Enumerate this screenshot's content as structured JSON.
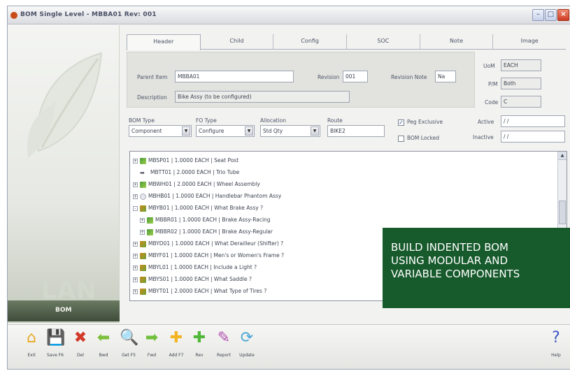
{
  "window": {
    "title": "BOM Single Level - MBBA01  Rev: 001"
  },
  "tabs": [
    "Header",
    "Child",
    "Config",
    "SOC",
    "Note",
    "Image"
  ],
  "header": {
    "parent_item_label": "Parent Item",
    "parent_item_value": "MBBA01",
    "revision_label": "Revision",
    "revision_value": "001",
    "revision_note_label": "Revision Note",
    "revision_note_value": "Na",
    "description_label": "Description",
    "description_value": "Bike Assy (to be configured)",
    "uom_label": "UoM",
    "uom_value": "EACH",
    "pm_label": "P/M",
    "pm_value": "Both",
    "code_label": "Code",
    "code_value": "C"
  },
  "selects": {
    "bom_type_label": "BOM Type",
    "bom_type_value": "Component",
    "fo_type_label": "FO Type",
    "fo_type_value": "Configure",
    "allocation_label": "Allocation",
    "allocation_value": "Std Qty",
    "route_label": "Route",
    "route_value": "BIKE2",
    "peg_exclusive_label": "Peg Exclusive",
    "peg_exclusive_checked": true,
    "bom_locked_label": "BOM Locked",
    "bom_locked_checked": false,
    "active_label": "Active",
    "active_value": "/ /",
    "inactive_label": "Inactive",
    "inactive_value": "/ /"
  },
  "tree": [
    {
      "expander": "+",
      "icon": "mod",
      "text": "MBSP01 | 1.0000 EACH | Seat Post"
    },
    {
      "expander": "",
      "icon": "arrow",
      "text": "MBTT01 | 2.0000 EACH | Trio Tube"
    },
    {
      "expander": "+",
      "icon": "mod",
      "text": "MBWH01 | 2.0000 EACH | Wheel Assembly"
    },
    {
      "expander": "+",
      "icon": "ghost",
      "text": "MBHB01 | 1.0000 EACH | Handlebar Phantom Assy"
    },
    {
      "expander": "-",
      "icon": "var",
      "text": "MBYB01 | 1.0000 EACH | What Brake Assy ?"
    },
    {
      "expander": "+",
      "icon": "mod",
      "text": "MBBR01 | 1.0000 EACH | Brake Assy-Racing"
    },
    {
      "expander": "+",
      "icon": "mod",
      "text": "MBBR02 | 1.0000 EACH | Brake Assy-Regular"
    },
    {
      "expander": "+",
      "icon": "var",
      "text": "MBYD01 | 1.0000 EACH | What Derailleur (Shifter) ?"
    },
    {
      "expander": "+",
      "icon": "var",
      "text": "MBYF01 | 1.0000 EACH | Men's or Women's Frame ?"
    },
    {
      "expander": "+",
      "icon": "var",
      "text": "MBYL01 | 1.0000 EACH | Include a Light ?"
    },
    {
      "expander": "+",
      "icon": "var",
      "text": "MBYS01 | 1.0000 EACH | What Saddle ?"
    },
    {
      "expander": "+",
      "icon": "var",
      "text": "MBYT01 | 2.0000 EACH | What Type of Tires ?"
    }
  ],
  "overlay": {
    "line1": "BUILD INDENTED BOM",
    "line2": "USING MODULAR AND",
    "line3": "VARIABLE COMPONENTS"
  },
  "left_panel": {
    "brand": "LAN",
    "module": "BOM"
  },
  "toolbar": [
    {
      "label": "Exit",
      "icon": "home-icon",
      "color": "#e8a821"
    },
    {
      "label": "Save F6",
      "icon": "save-icon",
      "color": "#3a7bd0"
    },
    {
      "label": "Del",
      "icon": "delete-icon",
      "color": "#d23a2a"
    },
    {
      "label": "Bwd",
      "icon": "back-icon",
      "color": "#7bbf3a"
    },
    {
      "label": "Get F5",
      "icon": "search-icon",
      "color": "#4a8fd6"
    },
    {
      "label": "Fwd",
      "icon": "forward-icon",
      "color": "#6fbf3a"
    },
    {
      "label": "Add F7",
      "icon": "add-icon",
      "color": "#f2b423"
    },
    {
      "label": "Rev",
      "icon": "revision-icon",
      "color": "#4fb83a"
    },
    {
      "label": "Report",
      "icon": "report-icon",
      "color": "#b04fb0"
    },
    {
      "label": "Update",
      "icon": "update-icon",
      "color": "#4aa7d6"
    },
    {
      "label": "Help",
      "icon": "help-icon",
      "color": "#3b57c6"
    }
  ]
}
